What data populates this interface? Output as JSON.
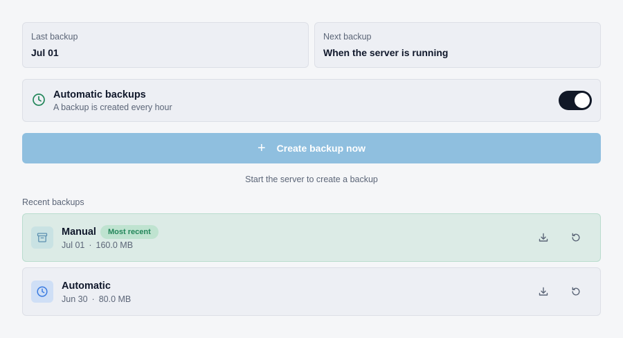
{
  "last_backup": {
    "label": "Last backup",
    "value": "Jul 01"
  },
  "next_backup": {
    "label": "Next backup",
    "value": "When the server is running"
  },
  "automatic": {
    "title": "Automatic backups",
    "subtitle": "A backup is created every hour",
    "enabled": true,
    "icon": "clock-icon"
  },
  "create_button": {
    "icon": "plus-icon",
    "label": "Create backup now"
  },
  "hint": "Start the server to create a backup",
  "recent": {
    "title": "Recent backups",
    "items": [
      {
        "name": "Manual",
        "badge": "Most recent",
        "date": "Jul 01",
        "separator": "·",
        "size": "160.0 MB",
        "icon": "archive-icon"
      },
      {
        "name": "Automatic",
        "date": "Jun 30",
        "separator": "·",
        "size": "80.0 MB",
        "icon": "clock-icon"
      }
    ]
  },
  "colors": {
    "accent_green": "#23865a",
    "button_bg": "#8fbfdf",
    "toggle_on": "#111827"
  }
}
